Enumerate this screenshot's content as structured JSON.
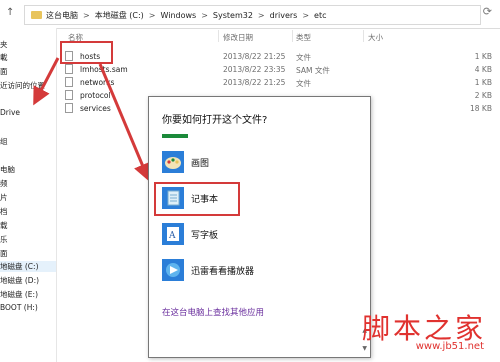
{
  "address_bar": {
    "breadcrumbs": [
      "这台电脑",
      "本地磁盘 (C:)",
      "Windows",
      "System32",
      "drivers",
      "etc"
    ],
    "separator": ">"
  },
  "sidebar": {
    "items": [
      "夹",
      "載",
      "面",
      "近访问的位置",
      "Drive",
      "组",
      "电脑",
      "频",
      "片",
      "档",
      "载",
      "乐",
      "面",
      "地磁盘 (C:)",
      "地磁盘 (D:)",
      "地磁盘 (E:)",
      "BOOT (H:)"
    ]
  },
  "file_list": {
    "columns": {
      "name": "名称",
      "date": "修改日期",
      "type": "类型",
      "size": "大小"
    },
    "rows": [
      {
        "name": "hosts",
        "date": "2013/8/22 21:25",
        "type": "文件",
        "size": "1 KB"
      },
      {
        "name": "lmhosts.sam",
        "date": "2013/8/22 23:35",
        "type": "SAM 文件",
        "size": "4 KB"
      },
      {
        "name": "networks",
        "date": "2013/8/22 21:25",
        "type": "文件",
        "size": "1 KB"
      },
      {
        "name": "protocol",
        "date": "",
        "type": "",
        "size": "2 KB"
      },
      {
        "name": "services",
        "date": "",
        "type": "",
        "size": "18 KB"
      }
    ]
  },
  "dialog": {
    "title": "你要如何打开这个文件?",
    "options": [
      {
        "label": "画图",
        "icon": "paint-icon"
      },
      {
        "label": "记事本",
        "icon": "notepad-icon"
      },
      {
        "label": "写字板",
        "icon": "wordpad-icon"
      },
      {
        "label": "迅雷看看播放器",
        "icon": "xunlei-player-icon"
      }
    ],
    "more_link": "在这台电脑上查找其他应用"
  },
  "watermark": {
    "text": "脚本之家",
    "url": "www.jb51.net"
  },
  "colors": {
    "highlight_box": "#d43a3a",
    "link": "#6a2f9e",
    "accent_bar": "#1b8a3a"
  }
}
